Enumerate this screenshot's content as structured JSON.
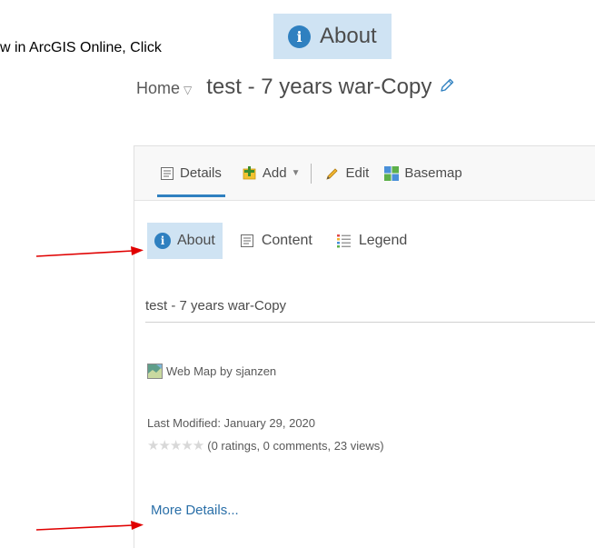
{
  "instruction": "w in ArcGIS Online, Click",
  "callout": {
    "icon": "info-icon",
    "icon_glyph": "i",
    "label": "About"
  },
  "header": {
    "home_label": "Home",
    "home_caret": "▽",
    "title": "test - 7 years war-Copy",
    "edit_icon": "pencil-icon"
  },
  "toolbar": {
    "details_label": "Details",
    "add_label": "Add",
    "add_caret": "▼",
    "edit_label": "Edit",
    "basemap_label": "Basemap"
  },
  "tabs": {
    "about_label": "About",
    "content_label": "Content",
    "legend_label": "Legend"
  },
  "item": {
    "title": "test - 7 years war-Copy",
    "type_owner": "Web Map by sjanzen",
    "last_modified": "Last Modified: January 29, 2020",
    "stars": "★★★★★",
    "stats": "(0 ratings, 0 comments, 23 views)",
    "more_details": "More Details..."
  },
  "colors": {
    "accent_blue": "#2f80c0",
    "highlight": "#cfe3f3",
    "arrow_red": "#e00000",
    "link": "#2a6fa8"
  }
}
